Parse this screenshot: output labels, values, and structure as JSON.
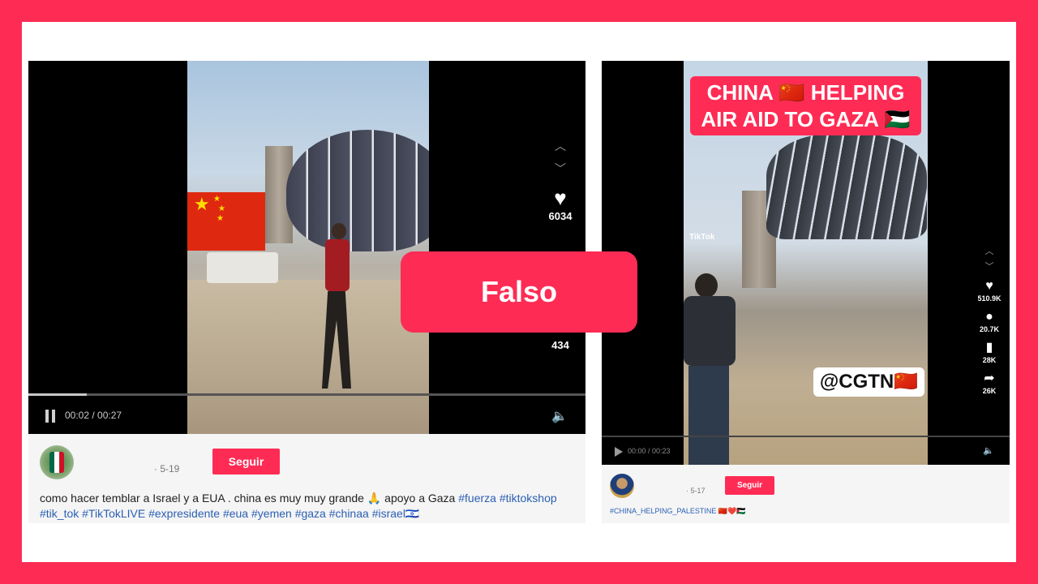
{
  "verdict": "Falso",
  "left_post": {
    "video": {
      "likes": "6034",
      "shares": "434",
      "time": "00:02 / 00:27"
    },
    "date": "· 5-19",
    "follow_label": "Seguir",
    "caption_text": "como hacer temblar a Israel y a EUA . china es muy muy grande 🙏 apoyo a Gaza ",
    "hashtags": [
      "#fuerza",
      "#tiktokshop",
      "#tik_tok",
      "#TikTokLIVE",
      "#expresidente",
      "#eua",
      "#yemen",
      "#gaza",
      "#chinaa",
      "#israel🇮🇱"
    ]
  },
  "right_post": {
    "video": {
      "banner_line1": "CHINA 🇨🇳 HELPING",
      "banner_line2": "AIR AID TO GAZA 🇵🇸",
      "cgtn_label": "@CGTN🇨🇳",
      "watermark": "TikTok",
      "likes": "510.9K",
      "comments": "20.7K",
      "saves": "28K",
      "shares": "26K",
      "time": "00:00 / 00:23"
    },
    "date": "· 5-17",
    "follow_label": "Seguir",
    "caption": "#CHINA_HELPING_PALESTINE 🇨🇳❤️🇵🇸"
  },
  "colors": {
    "brand": "#fe2c55",
    "hashtag": "#2b5fb3",
    "background": "#ffffff"
  },
  "icons": [
    "chevron-up-icon",
    "chevron-down-icon",
    "heart-icon",
    "comment-icon",
    "bookmark-icon",
    "share-icon",
    "pause-icon",
    "play-icon",
    "volume-icon"
  ]
}
